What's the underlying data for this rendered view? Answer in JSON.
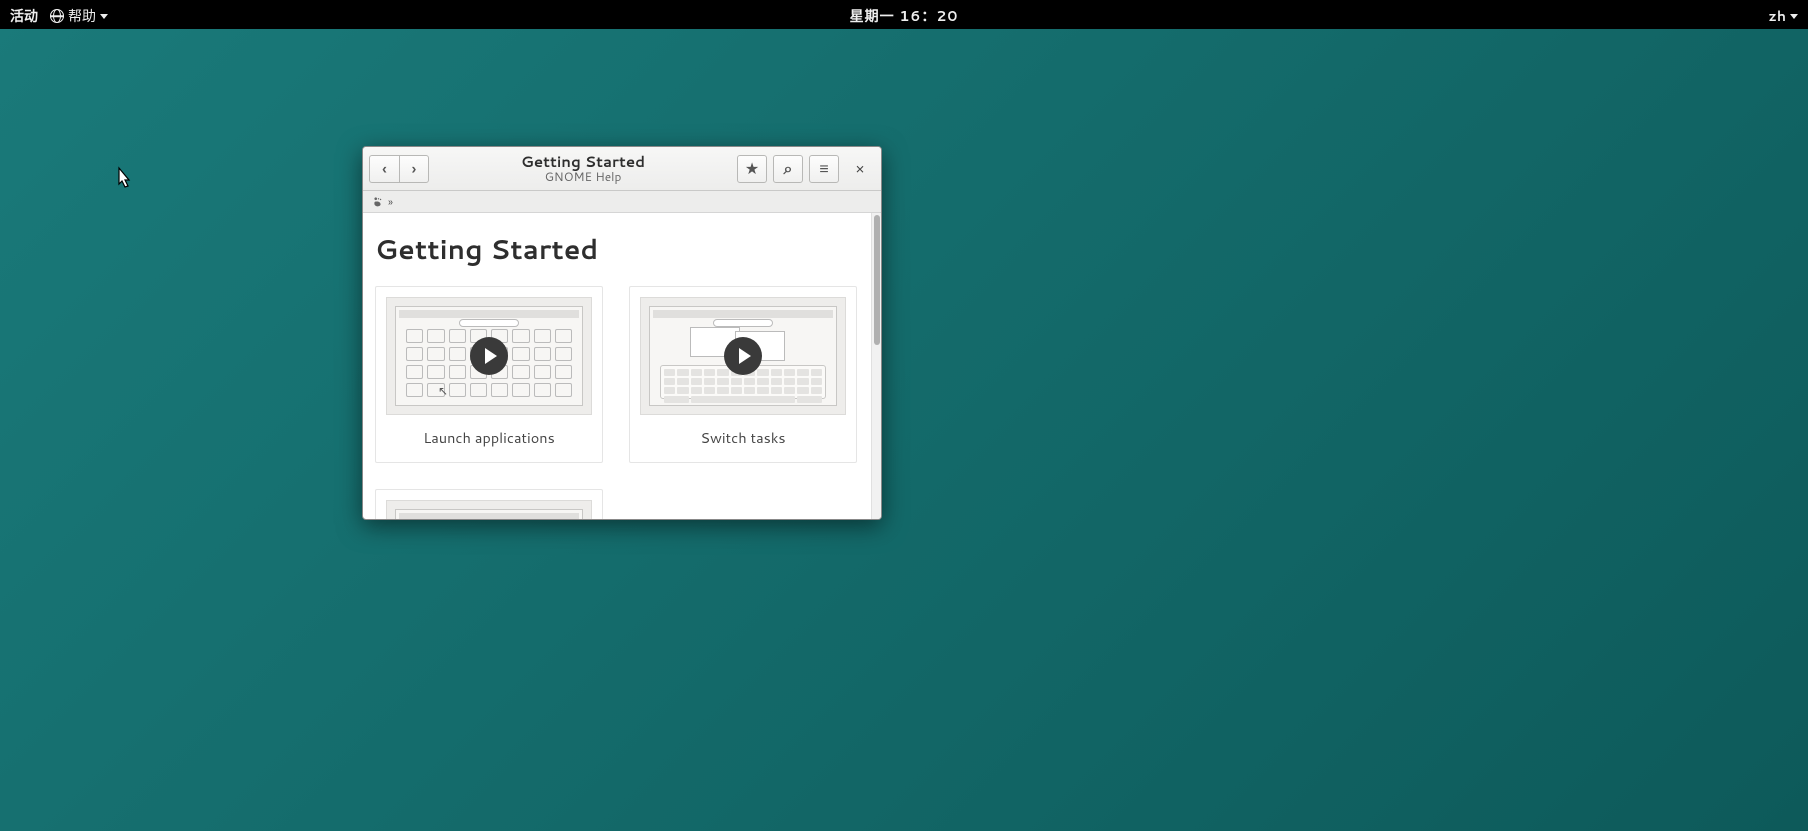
{
  "topbar": {
    "activities": "活动",
    "app_menu": "帮助",
    "clock": "星期一 16：20",
    "input_method": "zh"
  },
  "window": {
    "title": "Getting Started",
    "subtitle": "GNOME Help",
    "breadcrumb_separator": "»",
    "page_heading": "Getting Started",
    "cards": [
      {
        "label": "Launch applications"
      },
      {
        "label": "Switch tasks"
      }
    ]
  },
  "icons": {
    "back": "‹",
    "forward": "›",
    "star": "★",
    "search": "⌕",
    "menu": "≡",
    "close": "×"
  }
}
